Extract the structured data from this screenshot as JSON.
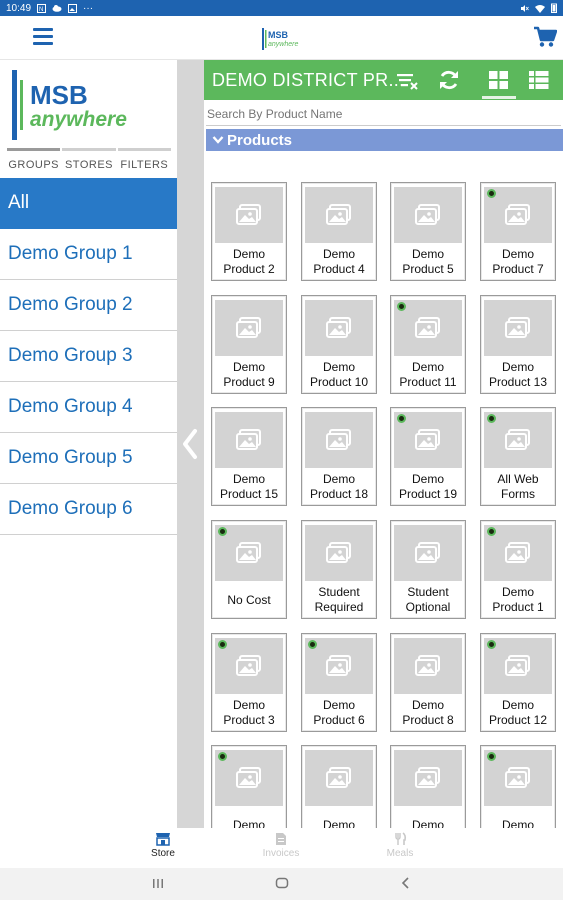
{
  "status_bar": {
    "time": "10:49",
    "dots": "···"
  },
  "app_bar": {
    "logo_top": "MSB",
    "logo_bottom": "anywhere"
  },
  "sidebar": {
    "logo": {
      "line1": "MSB",
      "line2": "anywhere"
    },
    "tabs": [
      {
        "label": "GROUPS"
      },
      {
        "label": "STORES"
      },
      {
        "label": "FILTERS"
      }
    ],
    "groups": [
      {
        "label": "All",
        "active": true
      },
      {
        "label": "Demo Group 1"
      },
      {
        "label": "Demo Group 2"
      },
      {
        "label": "Demo Group 3"
      },
      {
        "label": "Demo Group 4"
      },
      {
        "label": "Demo Group 5"
      },
      {
        "label": "Demo Group 6"
      }
    ]
  },
  "main": {
    "title": "DEMO DISTRICT PR...",
    "search_placeholder": "Search By Product Name",
    "section_title": "Products",
    "products": [
      {
        "line1": "Demo",
        "line2": "Product 2",
        "badge": false
      },
      {
        "line1": "Demo",
        "line2": "Product 4",
        "badge": false
      },
      {
        "line1": "Demo",
        "line2": "Product 5",
        "badge": false
      },
      {
        "line1": "Demo",
        "line2": "Product 7",
        "badge": true
      },
      {
        "line1": "Demo",
        "line2": "Product 9",
        "badge": false
      },
      {
        "line1": "Demo",
        "line2": "Product 10",
        "badge": false
      },
      {
        "line1": "Demo",
        "line2": "Product 11",
        "badge": true
      },
      {
        "line1": "Demo",
        "line2": "Product 13",
        "badge": false
      },
      {
        "line1": "Demo",
        "line2": "Product 15",
        "badge": false
      },
      {
        "line1": "Demo",
        "line2": "Product 18",
        "badge": false
      },
      {
        "line1": "Demo",
        "line2": "Product 19",
        "badge": true
      },
      {
        "line1": "All Web",
        "line2": "Forms",
        "badge": true
      },
      {
        "line1": "No Cost",
        "line2": "",
        "badge": true
      },
      {
        "line1": "Student",
        "line2": "Required",
        "badge": false
      },
      {
        "line1": "Student",
        "line2": "Optional",
        "badge": false
      },
      {
        "line1": "Demo",
        "line2": "Product 1",
        "badge": true
      },
      {
        "line1": "Demo",
        "line2": "Product 3",
        "badge": true
      },
      {
        "line1": "Demo",
        "line2": "Product 6",
        "badge": true
      },
      {
        "line1": "Demo",
        "line2": "Product 8",
        "badge": false
      },
      {
        "line1": "Demo",
        "line2": "Product 12",
        "badge": true
      },
      {
        "line1": "Demo",
        "line2": "",
        "badge": true
      },
      {
        "line1": "Demo",
        "line2": "",
        "badge": false
      },
      {
        "line1": "Demo",
        "line2": "",
        "badge": false
      },
      {
        "line1": "Demo",
        "line2": "",
        "badge": true
      }
    ]
  },
  "bottom_nav": [
    {
      "label": "Store",
      "icon": "store-icon",
      "active": true
    },
    {
      "label": "Invoices",
      "icon": "invoice-icon",
      "active": false
    },
    {
      "label": "Meals",
      "icon": "meals-icon",
      "active": false
    }
  ],
  "colors": {
    "brand_blue": "#1e63b0",
    "header_green": "#5cb85c",
    "section_blue": "#7b98d6",
    "active_group": "#2879c7"
  }
}
